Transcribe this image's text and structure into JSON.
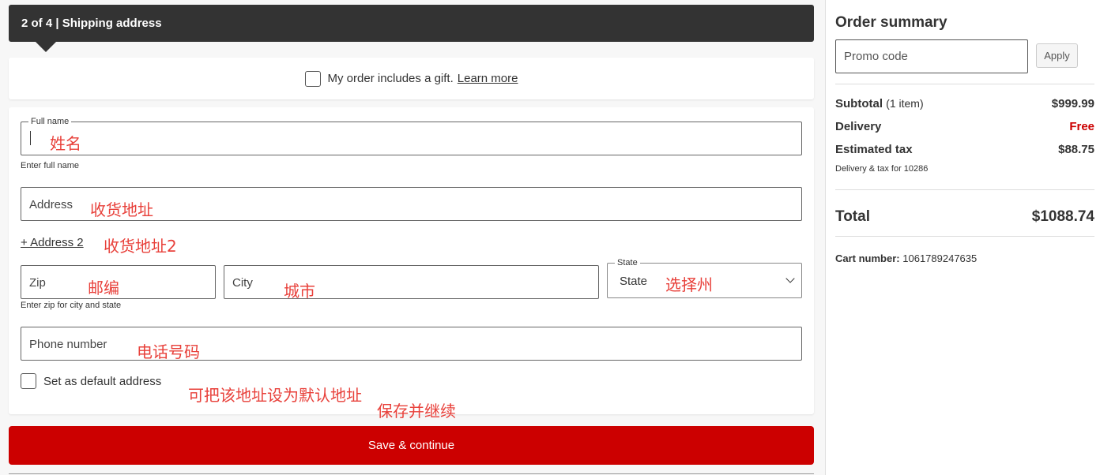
{
  "step": {
    "title": "2 of 4 | Shipping address"
  },
  "gift": {
    "label": "My order includes a gift.",
    "link": "Learn more"
  },
  "form": {
    "full_name": {
      "legend": "Full name",
      "hint": "Enter full name",
      "annotation": "姓名"
    },
    "address": {
      "placeholder": "Address",
      "annotation": "收货地址"
    },
    "address2": {
      "link": "+ Address 2",
      "annotation": "收货地址2"
    },
    "zip": {
      "placeholder": "Zip",
      "hint": "Enter zip for city and state",
      "annotation": "邮编"
    },
    "city": {
      "placeholder": "City",
      "annotation": "城市"
    },
    "state": {
      "legend": "State",
      "value": "State",
      "annotation": "选择州"
    },
    "phone": {
      "placeholder": "Phone number",
      "annotation": "电话号码"
    },
    "default": {
      "label": "Set as default address",
      "annotation": "可把该地址设为默认地址"
    },
    "save": {
      "label": "Save & continue",
      "annotation": "保存并继续"
    }
  },
  "summary": {
    "title": "Order summary",
    "promo_placeholder": "Promo code",
    "apply_label": "Apply",
    "subtotal_label": "Subtotal",
    "subtotal_count": "(1 item)",
    "subtotal_value": "$999.99",
    "delivery_label": "Delivery",
    "delivery_value": "Free",
    "tax_label": "Estimated tax",
    "tax_value": "$88.75",
    "tax_note": "Delivery & tax for 10286",
    "total_label": "Total",
    "total_value": "$1088.74",
    "cart_label": "Cart number:",
    "cart_value": "1061789247635"
  },
  "colors": {
    "accent": "#cc0000",
    "header": "#333333",
    "annotation": "#e8403a"
  }
}
